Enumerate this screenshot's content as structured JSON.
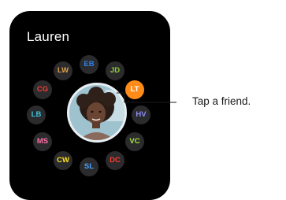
{
  "watch": {
    "title": "Lauren",
    "friends": [
      {
        "initials": "EB",
        "color": "#2f80e6",
        "selected": false
      },
      {
        "initials": "JD",
        "color": "#8fd13a",
        "selected": false
      },
      {
        "initials": "LT",
        "color": "#ff8c19",
        "selected": true
      },
      {
        "initials": "HV",
        "color": "#8e8ef7",
        "selected": false
      },
      {
        "initials": "VC",
        "color": "#a8e63a",
        "selected": false
      },
      {
        "initials": "DC",
        "color": "#ff3b30",
        "selected": false
      },
      {
        "initials": "SL",
        "color": "#4aa3ff",
        "selected": false
      },
      {
        "initials": "CW",
        "color": "#ffe11a",
        "selected": false
      },
      {
        "initials": "MS",
        "color": "#ff6fa8",
        "selected": false
      },
      {
        "initials": "LB",
        "color": "#3cc4d8",
        "selected": false
      },
      {
        "initials": "CG",
        "color": "#ff3b30",
        "selected": false
      },
      {
        "initials": "LW",
        "color": "#e0a14a",
        "selected": false
      }
    ]
  },
  "callout": {
    "label": "Tap a friend."
  }
}
